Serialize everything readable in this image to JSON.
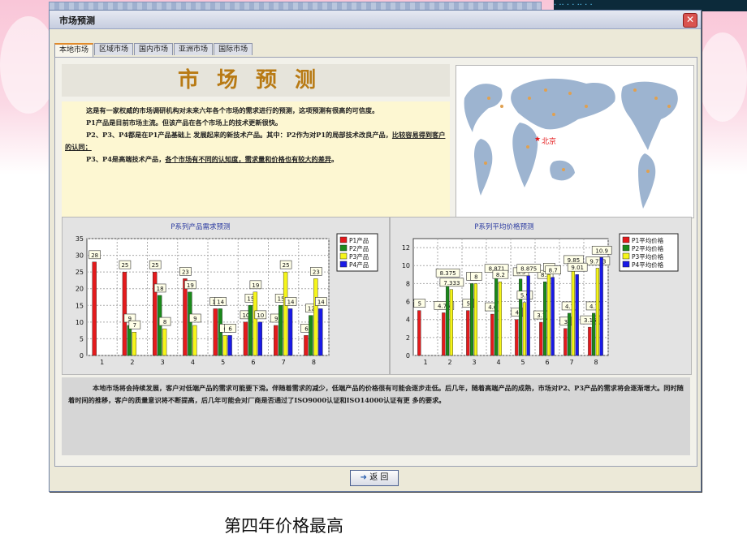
{
  "window": {
    "title": "市场预测",
    "close_label": "✕"
  },
  "top_strip_text": "· ·· ·  · ·· · ·",
  "tabs": [
    {
      "label": "本地市场",
      "active": true
    },
    {
      "label": "区域市场",
      "active": false
    },
    {
      "label": "国内市场",
      "active": false
    },
    {
      "label": "亚洲市场",
      "active": false
    },
    {
      "label": "国际市场",
      "active": false
    }
  ],
  "header_title": "市场预测",
  "intro": {
    "p1": "这是有一家权威的市场调研机构对未来六年各个市场的需求进行的预测，这项预测有很高的可信度。",
    "p2": "P1产品是目前市场主流。但该产品在各个市场上的技术更新很快。",
    "p3a": "P2、P3、P4都是在P1产品基础上 发展起来的新技术产品。其中：P2作为对P1的局部技术改良产品，",
    "p3b": "比较容易得到客户的认同；",
    "p4a": "P3、P4是高端技术产品，",
    "p4b": "各个市场有不同的认知度，需求量和价格也有较大的差异",
    "p4c": "。"
  },
  "map": {
    "city_label": "北京",
    "star": "★"
  },
  "bottom_text": "本地市场将会持续发展，客户对低端产品的需求可能要下滑。伴随着需求的减少，低端产品的价格很有可能会逐步走低。后几年，随着高端产品的成熟，市场对P2、P3产品的需求将会逐渐增大。同时随着时间的推移，客户的质量意识将不断提高，后几年可能会对厂商是否通过了ISO9000认证和ISO14000认证有更 多的要求。",
  "back_button": {
    "label": "返 回"
  },
  "caption": "第四年价格最高",
  "colors": {
    "P1": "#e41a1c",
    "P2": "#1a8a1a",
    "P3": "#f5f51a",
    "P4": "#1a1ae6"
  },
  "chart_data": [
    {
      "type": "bar",
      "title": "P系列产品需求预测",
      "categories": [
        "1",
        "2",
        "3",
        "4",
        "5",
        "6",
        "7",
        "8"
      ],
      "ylim": [
        0,
        35
      ],
      "yticks": [
        0,
        5,
        10,
        15,
        20,
        25,
        30,
        35
      ],
      "series": [
        {
          "name": "P1产品",
          "values": [
            28,
            25,
            25,
            23,
            14,
            10,
            9,
            6
          ]
        },
        {
          "name": "P2产品",
          "values": [
            0,
            9,
            18,
            19,
            14,
            15,
            15,
            12
          ]
        },
        {
          "name": "P3产品",
          "values": [
            0,
            7,
            8,
            9,
            6,
            19,
            25,
            23
          ]
        },
        {
          "name": "P4产品",
          "values": [
            0,
            0,
            0,
            0,
            6,
            10,
            14,
            14
          ]
        }
      ],
      "grid": true,
      "legend": "top-right"
    },
    {
      "type": "bar",
      "title": "P系列平均价格预测",
      "categories": [
        "1",
        "2",
        "3",
        "4",
        "5",
        "6",
        "7",
        "8"
      ],
      "ylim": [
        0,
        13
      ],
      "yticks": [
        0,
        2,
        4,
        6,
        8,
        10,
        12
      ],
      "series": [
        {
          "name": "P1平均价格",
          "values": [
            5,
            4.75,
            5,
            4.6,
            4,
            3.7,
            3,
            3.15
          ]
        },
        {
          "name": "P2平均价格",
          "values": [
            0,
            8.375,
            8.0,
            8.871,
            8.5,
            8.2,
            4.7,
            4.7
          ]
        },
        {
          "name": "P3平均价格",
          "values": [
            0,
            7.333,
            8.0,
            8.2,
            5.9,
            9.0,
            9.85,
            9.713
          ]
        },
        {
          "name": "P4平均价格",
          "values": [
            0,
            0,
            0,
            0,
            8.875,
            8.7,
            9.01,
            10.9
          ]
        }
      ],
      "grid": true,
      "legend": "top-right"
    }
  ]
}
